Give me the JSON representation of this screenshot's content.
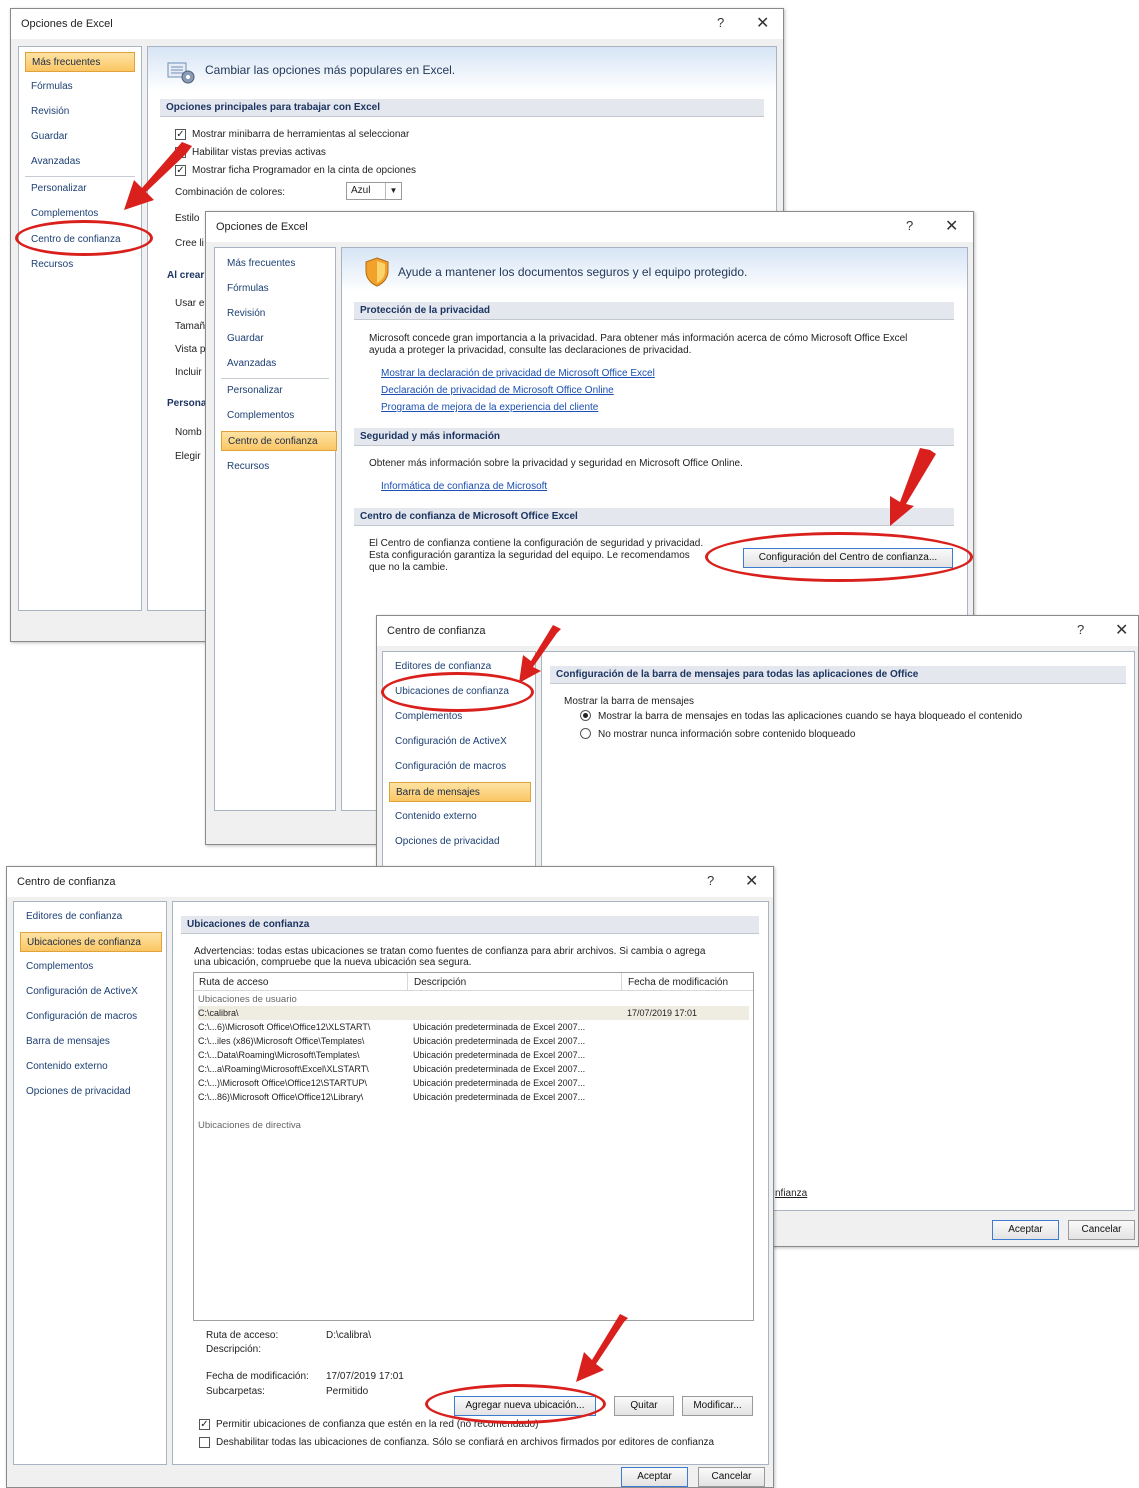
{
  "colors": {
    "selected_nav": "#fbc664",
    "annotation_red": "#d9201c",
    "link": "#1b4fb1"
  },
  "w1": {
    "title": "Opciones de Excel",
    "help": "?",
    "close": "✕",
    "nav": [
      "Más frecuentes",
      "Fórmulas",
      "Revisión",
      "Guardar",
      "Avanzadas",
      "Personalizar",
      "Complementos",
      "Centro de confianza",
      "Recursos"
    ],
    "header": "Cambiar las opciones más populares en Excel.",
    "section": "Opciones principales para trabajar con Excel",
    "opt1": "Mostrar minibarra de herramientas al seleccionar",
    "opt2": "Habilitar vistas previas activas",
    "opt3": "Mostrar ficha Programador en la cinta de opciones",
    "color_label": "Combinación de colores:",
    "color_value": "Azul",
    "estilo": "Estilo",
    "cree": "Cree li",
    "alcrear": "Al crear",
    "usar": "Usar e",
    "tama": "Tamañ",
    "vista": "Vista p",
    "incluir": "Incluir",
    "persona": "Persona",
    "nomb": "Nomb",
    "elegir": "Elegir"
  },
  "w2": {
    "title": "Opciones de Excel",
    "help": "?",
    "close": "✕",
    "nav": [
      "Más frecuentes",
      "Fórmulas",
      "Revisión",
      "Guardar",
      "Avanzadas",
      "Personalizar",
      "Complementos",
      "Centro de confianza",
      "Recursos"
    ],
    "header": "Ayude a mantener los documentos seguros y el equipo protegido.",
    "sec1": "Protección de la privacidad",
    "p1_line1": "Microsoft concede gran importancia a la privacidad. Para obtener más información acerca de cómo Microsoft Office Excel",
    "p1_line2": "ayuda a proteger la privacidad, consulte las declaraciones de privacidad.",
    "link1": "Mostrar la declaración de privacidad de Microsoft Office Excel",
    "link2": "Declaración de privacidad de Microsoft Office Online",
    "link3": "Programa de mejora de la experiencia del cliente",
    "sec2": "Seguridad y más información",
    "p2": "Obtener más información sobre la privacidad y seguridad en Microsoft Office Online.",
    "link4": "Informática de confianza de Microsoft",
    "sec3": "Centro de confianza de Microsoft Office Excel",
    "p3_line1": "El Centro de confianza contiene la configuración de seguridad y privacidad.",
    "p3_line2": "Esta configuración garantiza la seguridad del equipo. Le recomendamos",
    "p3_line3": "que no la cambie.",
    "config_btn": "Configuración del Centro de confianza..."
  },
  "w3": {
    "title": "Centro de confianza",
    "help": "?",
    "close": "✕",
    "nav": [
      "Editores de confianza",
      "Ubicaciones de confianza",
      "Complementos",
      "Configuración de ActiveX",
      "Configuración de macros",
      "Barra de mensajes",
      "Contenido externo",
      "Opciones de privacidad"
    ],
    "sec": "Configuración de la barra de mensajes para todas las aplicaciones de Office",
    "label": "Mostrar la barra de mensajes",
    "radio1": "Mostrar la barra de mensajes en todas las aplicaciones cuando se haya bloqueado el contenido",
    "radio2": "No mostrar nunca información sobre contenido bloqueado",
    "partial_link": "nfianza",
    "ok": "Aceptar",
    "cancel": "Cancelar"
  },
  "w4": {
    "title": "Centro de confianza",
    "help": "?",
    "close": "✕",
    "nav": [
      "Editores de confianza",
      "Ubicaciones de confianza",
      "Complementos",
      "Configuración de ActiveX",
      "Configuración de macros",
      "Barra de mensajes",
      "Contenido externo",
      "Opciones de privacidad"
    ],
    "sec": "Ubicaciones de confianza",
    "warn1": "Advertencias: todas estas ubicaciones se tratan como fuentes de confianza para abrir archivos. Si cambia o agrega",
    "warn2": "una ubicación, compruebe que la nueva ubicación sea segura.",
    "col_path": "Ruta de acceso",
    "col_desc": "Descripción",
    "col_date": "Fecha de modificación",
    "grp_user": "Ubicaciones de usuario",
    "rows": [
      {
        "path": "C:\\calibra\\",
        "desc": "",
        "date": "17/07/2019 17:01"
      },
      {
        "path": "C:\\...6)\\Microsoft Office\\Office12\\XLSTART\\",
        "desc": "Ubicación predeterminada de Excel 2007...",
        "date": ""
      },
      {
        "path": "C:\\...iles (x86)\\Microsoft Office\\Templates\\",
        "desc": "Ubicación predeterminada de Excel 2007...",
        "date": ""
      },
      {
        "path": "C:\\...Data\\Roaming\\Microsoft\\Templates\\",
        "desc": "Ubicación predeterminada de Excel 2007...",
        "date": ""
      },
      {
        "path": "C:\\...a\\Roaming\\Microsoft\\Excel\\XLSTART\\",
        "desc": "Ubicación predeterminada de Excel 2007...",
        "date": ""
      },
      {
        "path": "C:\\...)\\Microsoft Office\\Office12\\STARTUP\\",
        "desc": "Ubicación predeterminada de Excel 2007...",
        "date": ""
      },
      {
        "path": "C:\\...86)\\Microsoft Office\\Office12\\Library\\",
        "desc": "Ubicación predeterminada de Excel 2007...",
        "date": ""
      }
    ],
    "grp_policy": "Ubicaciones de directiva",
    "d_path_label": "Ruta de acceso:",
    "d_path": "D:\\calibra\\",
    "d_desc_label": "Descripción:",
    "d_date_label": "Fecha de modificación:",
    "d_date": "17/07/2019 17:01",
    "d_sub_label": "Subcarpetas:",
    "d_sub": "Permitido",
    "add_btn": "Agregar nueva ubicación...",
    "remove_btn": "Quitar",
    "modify_btn": "Modificar...",
    "chk1": "Permitir ubicaciones de confianza que estén en la red (no recomendado)",
    "chk2": "Deshabilitar todas las ubicaciones de confianza. Sólo se confiará en archivos firmados por editores de confianza",
    "ok": "Aceptar",
    "cancel": "Cancelar"
  }
}
